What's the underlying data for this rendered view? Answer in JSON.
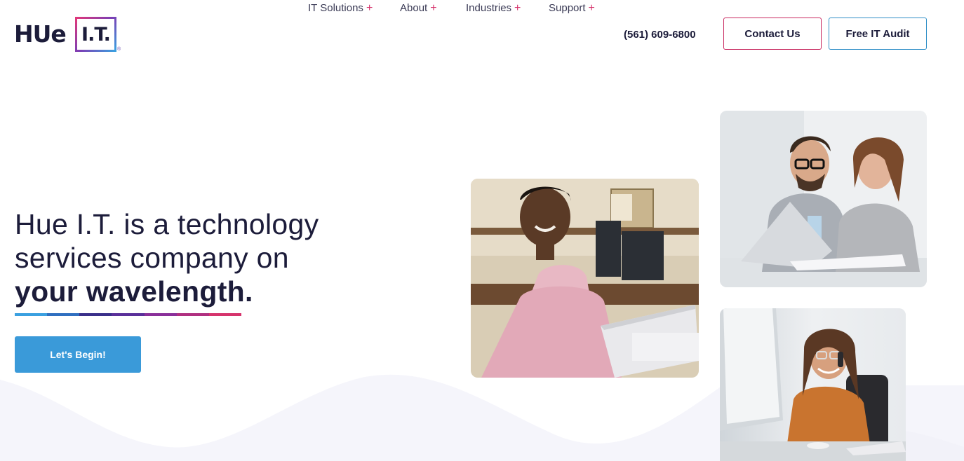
{
  "logo": {
    "wordmark": "HUe",
    "box_text": "I.T.",
    "reg_mark": "®"
  },
  "nav": {
    "items": [
      {
        "label": "IT Solutions",
        "plus": "+"
      },
      {
        "label": "About",
        "plus": "+"
      },
      {
        "label": "Industries",
        "plus": "+"
      },
      {
        "label": "Support",
        "plus": "+"
      }
    ],
    "phone": "(561) 609-6800",
    "contact_label": "Contact Us",
    "audit_label": "Free IT Audit"
  },
  "hero": {
    "line1": "Hue I.T. is a technology",
    "line2": "services company on",
    "accent": "your wavelength.",
    "cta_label": "Let's Begin!"
  },
  "colors": {
    "brand_pink": "#d6336c",
    "brand_blue": "#3a9ad9",
    "brand_purple": "#7b3fb5",
    "text_dark": "#1c1c3a",
    "underline": [
      "#3aa0e0",
      "#2f6fc0",
      "#3a2f8a",
      "#5a2f9a",
      "#8a2f9a",
      "#b02f80",
      "#d6336c"
    ]
  },
  "icons": {
    "nav_expand": "plus-icon"
  },
  "images": [
    {
      "name": "man-at-laptop-photo"
    },
    {
      "name": "couple-at-laptop-photo"
    },
    {
      "name": "woman-on-phone-photo"
    }
  ]
}
